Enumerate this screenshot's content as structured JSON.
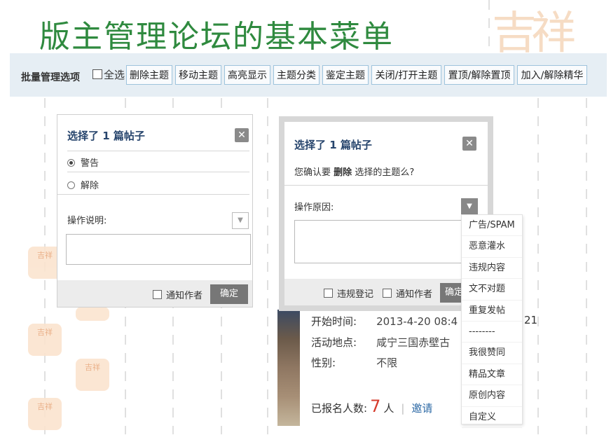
{
  "slide_title": "版主管理论坛的基本菜单",
  "toolbar": {
    "label": "批量管理选项",
    "select_all": "全选",
    "buttons": [
      "删除主题",
      "移动主题",
      "高亮显示",
      "主题分类",
      "鉴定主题",
      "关闭/打开主题",
      "置顶/解除置顶",
      "加入/解除精华"
    ]
  },
  "dialog_left": {
    "title": "选择了 1 篇帖子",
    "close": "✕",
    "options": [
      "警告",
      "解除"
    ],
    "selected": "警告",
    "desc_label": "操作说明:",
    "notify_label": "通知作者",
    "confirm": "确定"
  },
  "dialog_right": {
    "title": "选择了 1 篇帖子",
    "close": "✕",
    "confirm_prefix": "您确认要",
    "confirm_action": "删除",
    "confirm_suffix": "选择的主题么?",
    "reason_label": "操作原因:",
    "violation_label": "违规登记",
    "notify_label": "通知作者",
    "confirm": "确定"
  },
  "reason_options": [
    "广告/SPAM",
    "恶意灌水",
    "违规内容",
    "文不对题",
    "重复发帖",
    "--------",
    "我很赞同",
    "精品文章",
    "原创内容",
    "自定义"
  ],
  "event_info": {
    "start_label": "开始时间:",
    "start_value": "2013-4-20 08:4",
    "end_fragment": "21",
    "place_label": "活动地点:",
    "place_value": "咸宁三国赤壁古",
    "gender_label": "性别:",
    "gender_value": "不限",
    "signup_label": "已报名人数:",
    "signup_count": "7",
    "signup_unit": "人",
    "invite": "邀请"
  },
  "colors": {
    "title_green": "#2f8a3f",
    "toolbar_bg": "#e6eef4",
    "dialog_title": "#27456d",
    "count_red": "#d63b2c"
  }
}
